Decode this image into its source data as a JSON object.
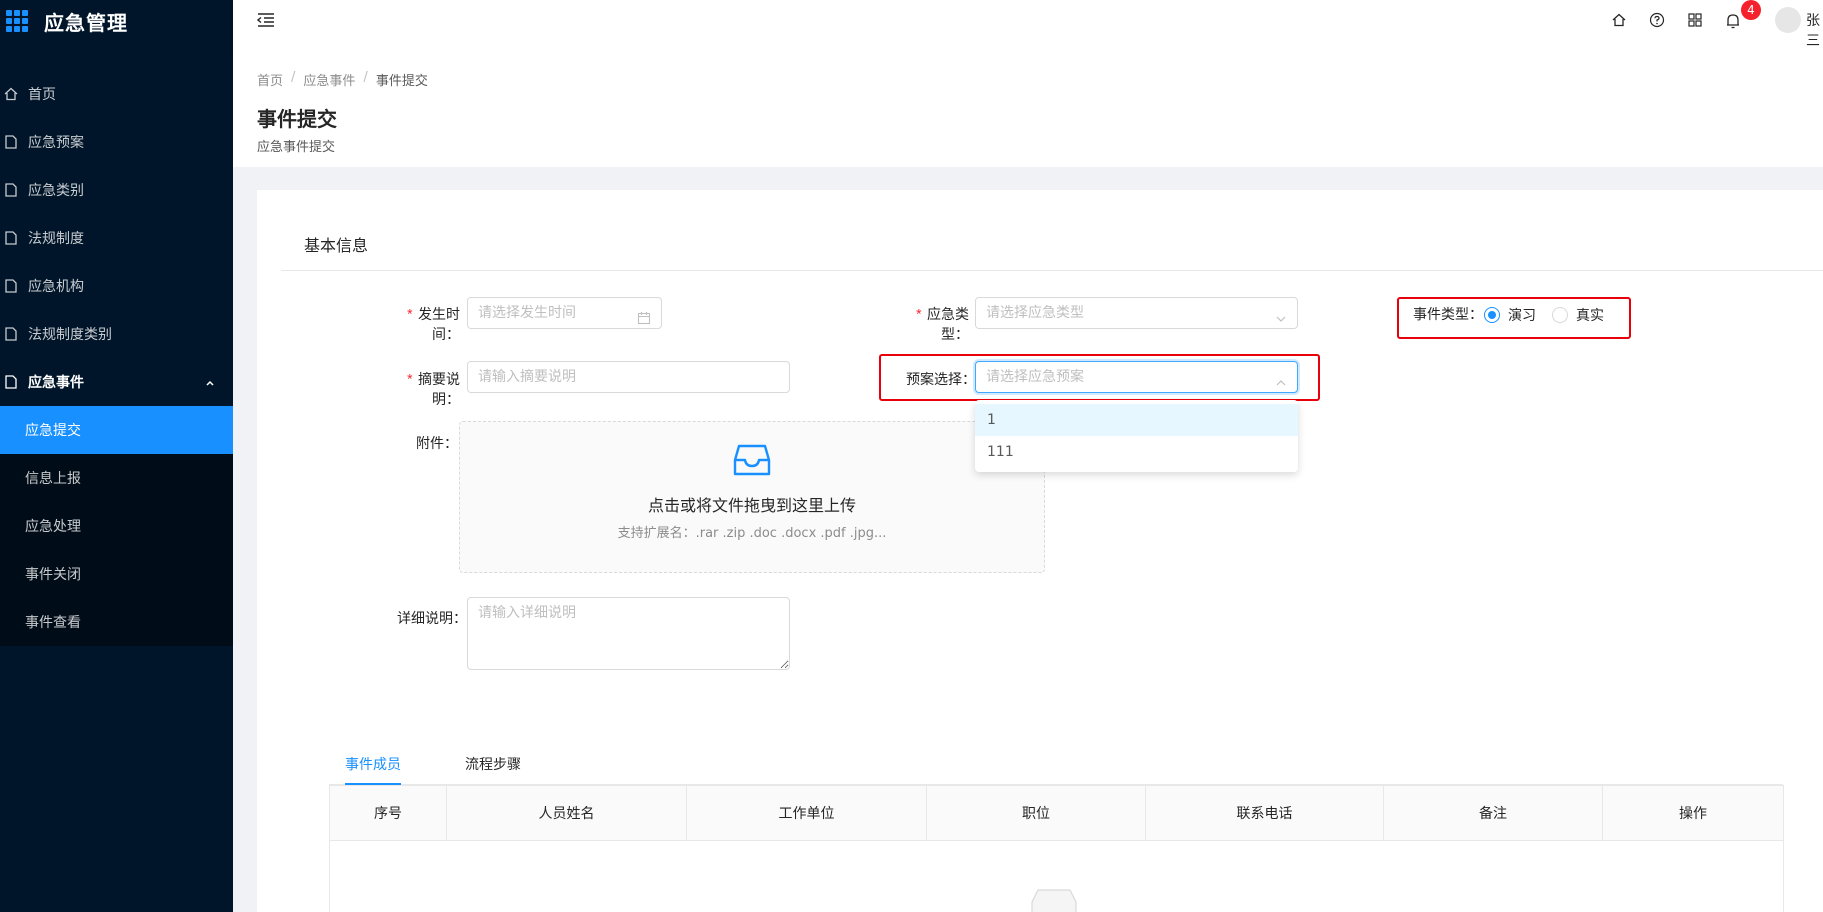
{
  "app": {
    "title": "应急管理"
  },
  "sidebar": {
    "items": [
      {
        "label": "首页",
        "icon": "home-icon"
      },
      {
        "label": "应急预案",
        "icon": "file-icon"
      },
      {
        "label": "应急类别",
        "icon": "file-icon"
      },
      {
        "label": "法规制度",
        "icon": "file-icon"
      },
      {
        "label": "应急机构",
        "icon": "file-icon"
      },
      {
        "label": "法规制度类别",
        "icon": "file-icon"
      },
      {
        "label": "应急事件",
        "icon": "file-icon",
        "expanded": true
      }
    ],
    "submenu": [
      {
        "label": "应急提交",
        "active": true
      },
      {
        "label": "信息上报"
      },
      {
        "label": "应急处理"
      },
      {
        "label": "事件关闭"
      },
      {
        "label": "事件查看"
      }
    ]
  },
  "header": {
    "notification_count": "4",
    "username": "张三"
  },
  "breadcrumb": [
    "首页",
    "应急事件",
    "事件提交"
  ],
  "page": {
    "title": "事件提交",
    "subtitle": "应急事件提交"
  },
  "form": {
    "section_title": "基本信息",
    "occur_time": {
      "label": "发生时间",
      "placeholder": "请选择发生时间"
    },
    "emergency_type": {
      "label": "应急类型",
      "placeholder": "请选择应急类型"
    },
    "event_type": {
      "label": "事件类型",
      "options": [
        "演习",
        "真实"
      ],
      "selected": "演习"
    },
    "summary": {
      "label": "摘要说明",
      "placeholder": "请输入摘要说明"
    },
    "plan": {
      "label": "预案选择",
      "placeholder": "请选择应急预案",
      "options": [
        "1",
        "111"
      ]
    },
    "attachment": {
      "label": "附件",
      "text": "点击或将文件拖曳到这里上传",
      "hint": "支持扩展名：.rar .zip .doc .docx .pdf .jpg..."
    },
    "detail": {
      "label": "详细说明",
      "placeholder": "请输入详细说明"
    }
  },
  "tabs": [
    "事件成员",
    "流程步骤"
  ],
  "table": {
    "columns": [
      "序号",
      "人员姓名",
      "工作单位",
      "职位",
      "联系电话",
      "备注",
      "操作"
    ]
  },
  "colors": {
    "primary": "#1890ff",
    "sidebar": "#001529",
    "highlight": "#e8000b"
  }
}
